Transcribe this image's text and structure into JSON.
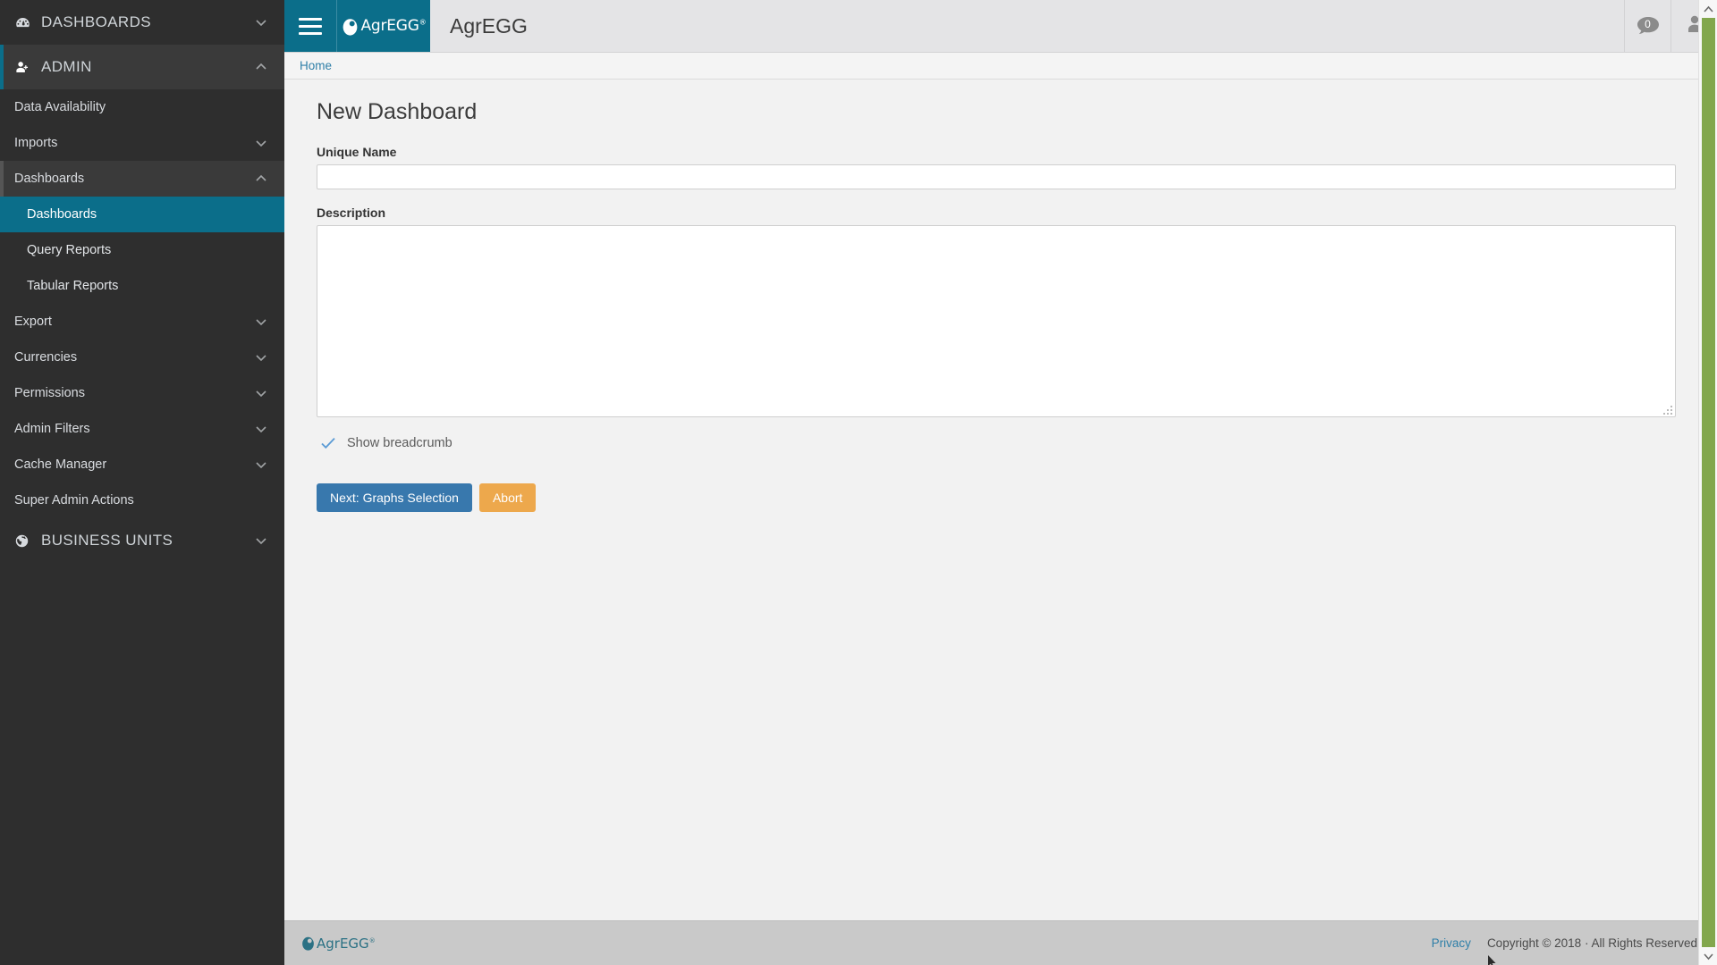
{
  "sidebar": {
    "sections": [
      {
        "id": "dashboards",
        "label": "DASHBOARDS",
        "icon": "gauge-icon",
        "chevron": "chevron-down-icon",
        "open": false
      },
      {
        "id": "admin",
        "label": "ADMIN",
        "icon": "user-plus-icon",
        "chevron": "chevron-up-icon",
        "open": true
      }
    ],
    "admin_items": [
      {
        "label": "Data Availability",
        "chevron": ""
      },
      {
        "label": "Imports",
        "chevron": "chevron-down-icon"
      },
      {
        "label": "Dashboards",
        "chevron": "chevron-up-icon",
        "expanded": true
      },
      {
        "label": "Export",
        "chevron": "chevron-down-icon"
      },
      {
        "label": "Currencies",
        "chevron": "chevron-down-icon"
      },
      {
        "label": "Permissions",
        "chevron": "chevron-down-icon"
      },
      {
        "label": "Admin Filters",
        "chevron": "chevron-down-icon"
      },
      {
        "label": "Cache Manager",
        "chevron": "chevron-down-icon"
      },
      {
        "label": "Super Admin Actions",
        "chevron": ""
      }
    ],
    "dashboards_subitems": [
      {
        "label": "Dashboards",
        "active": true
      },
      {
        "label": "Query Reports",
        "active": false
      },
      {
        "label": "Tabular Reports",
        "active": false
      }
    ],
    "business_units": {
      "label": "BUSINESS UNITS",
      "icon": "globe-icon",
      "chevron": "chevron-down-icon"
    },
    "colors": {
      "background": "#2e2e2e",
      "active": "#0b6e8a",
      "expanded": "#3a3a3a"
    }
  },
  "header": {
    "menu_icon": "hamburger-icon",
    "brand": {
      "name": "AgrEGG",
      "trademark": "®",
      "icon": "egg-logo-icon"
    },
    "title": "AgrEGG",
    "messages_icon": "chat-bubble-icon",
    "messages_count": "0",
    "user_icon": "user-avatar-icon"
  },
  "breadcrumb": {
    "items": [
      "Home"
    ]
  },
  "main": {
    "page_title": "New Dashboard",
    "fields": {
      "unique_name": {
        "label": "Unique Name",
        "value": "",
        "placeholder": ""
      },
      "description": {
        "label": "Description",
        "value": "",
        "placeholder": ""
      }
    },
    "checkbox": {
      "label": "Show breadcrumb",
      "checked": true,
      "icon": "check-icon"
    },
    "buttons": {
      "next": {
        "label": "Next: Graphs Selection",
        "color": "#3878ad"
      },
      "abort": {
        "label": "Abort",
        "color": "#eda84c"
      }
    }
  },
  "footer": {
    "brand": {
      "name": "AgrEGG",
      "trademark": "®",
      "icon": "egg-logo-icon"
    },
    "privacy_label": "Privacy",
    "copyright": "Copyright © 2018 · All Rights Reserved"
  },
  "scrollbar": {
    "up_icon": "chevron-up-icon",
    "down_icon": "chevron-down-icon",
    "thumb_color": "#82a74d"
  }
}
